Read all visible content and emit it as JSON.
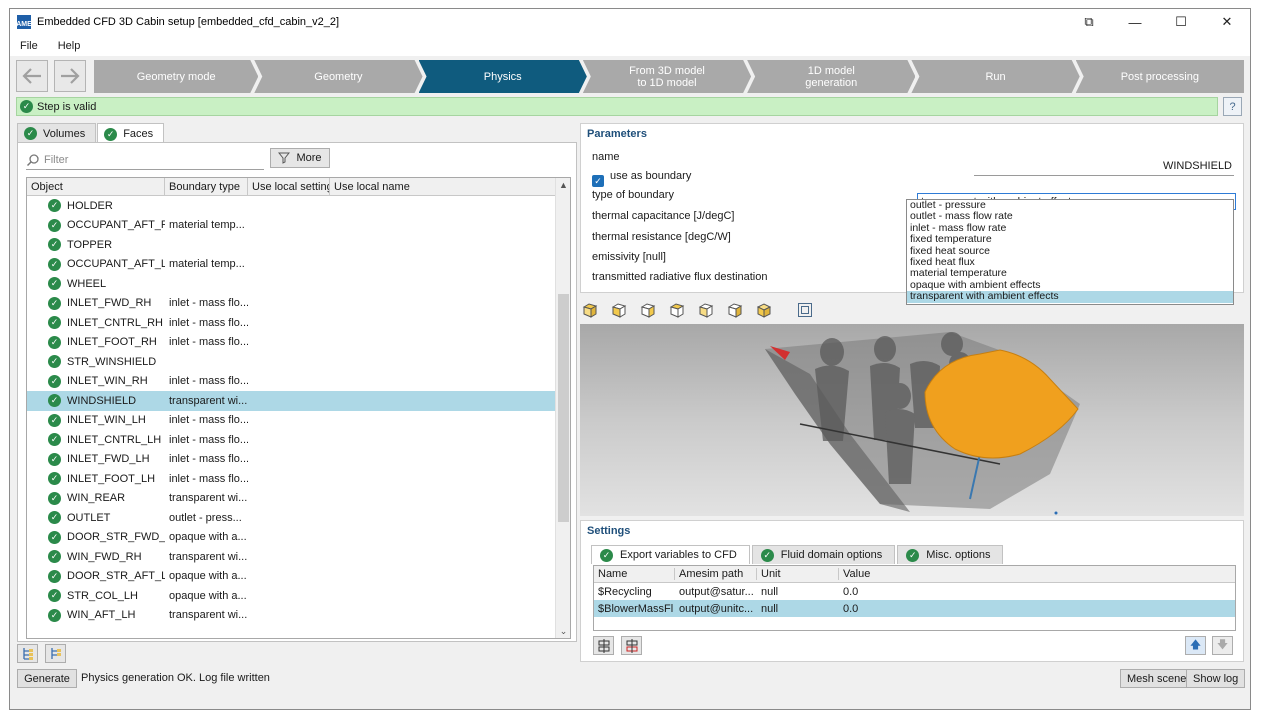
{
  "window": {
    "title": "Embedded CFD 3D Cabin setup [embedded_cfd_cabin_v2_2]",
    "app_icon_text": "AME",
    "controls": {
      "restore": "⧉",
      "minimize": "—",
      "maximize": "☐",
      "close": "✕"
    }
  },
  "menu": [
    "File",
    "Help"
  ],
  "stepper": {
    "back_icon": "arrow-left-icon",
    "forward_icon": "arrow-right-icon",
    "steps": [
      {
        "line1": "Geometry mode",
        "line2": ""
      },
      {
        "line1": "Geometry",
        "line2": ""
      },
      {
        "line1": "Physics",
        "line2": ""
      },
      {
        "line1": "From 3D model",
        "line2": "to 1D model"
      },
      {
        "line1": "1D model",
        "line2": "generation"
      },
      {
        "line1": "Run",
        "line2": ""
      },
      {
        "line1": "Post processing",
        "line2": ""
      }
    ],
    "active_index": 2,
    "active_color": "#0f5b7e",
    "inactive_color": "#a9a9a9"
  },
  "validation": {
    "text": "Step is valid",
    "help": "?",
    "color": "#c9f0c4"
  },
  "left": {
    "tabs": [
      "Volumes",
      "Faces"
    ],
    "active_tab": 1,
    "filter_placeholder": "Filter",
    "more_label": "More",
    "columns": [
      "Object",
      "Boundary type",
      "Use local settings",
      "Use local name"
    ],
    "rows": [
      {
        "object": "HOLDER",
        "boundary": ""
      },
      {
        "object": "OCCUPANT_AFT_RH",
        "boundary": "material temp..."
      },
      {
        "object": "TOPPER",
        "boundary": ""
      },
      {
        "object": "OCCUPANT_AFT_LH",
        "boundary": "material temp..."
      },
      {
        "object": "WHEEL",
        "boundary": ""
      },
      {
        "object": "INLET_FWD_RH",
        "boundary": "inlet - mass flo..."
      },
      {
        "object": "INLET_CNTRL_RH",
        "boundary": "inlet - mass flo..."
      },
      {
        "object": "INLET_FOOT_RH",
        "boundary": "inlet - mass flo..."
      },
      {
        "object": "STR_WINSHIELD",
        "boundary": ""
      },
      {
        "object": "INLET_WIN_RH",
        "boundary": "inlet - mass flo..."
      },
      {
        "object": "WINDSHIELD",
        "boundary": "transparent wi...",
        "selected": true
      },
      {
        "object": "INLET_WIN_LH",
        "boundary": "inlet - mass flo..."
      },
      {
        "object": "INLET_CNTRL_LH",
        "boundary": "inlet - mass flo..."
      },
      {
        "object": "INLET_FWD_LH",
        "boundary": "inlet - mass flo..."
      },
      {
        "object": "INLET_FOOT_LH",
        "boundary": "inlet - mass flo..."
      },
      {
        "object": "WIN_REAR",
        "boundary": "transparent wi..."
      },
      {
        "object": "OUTLET",
        "boundary": "outlet - press..."
      },
      {
        "object": "DOOR_STR_FWD_RH",
        "boundary": "opaque with a..."
      },
      {
        "object": "WIN_FWD_RH",
        "boundary": "transparent wi..."
      },
      {
        "object": "DOOR_STR_AFT_LH",
        "boundary": "opaque with a..."
      },
      {
        "object": "STR_COL_LH",
        "boundary": "opaque with a..."
      },
      {
        "object": "WIN_AFT_LH",
        "boundary": "transparent wi..."
      }
    ]
  },
  "status": {
    "generate_label": "Generate",
    "message": "Physics generation OK. Log file written"
  },
  "parameters": {
    "title": "Parameters",
    "name_label": "name",
    "name_value": "WINDSHIELD",
    "use_as_boundary_label": "use as boundary",
    "use_as_boundary_checked": true,
    "type_label": "type of boundary",
    "type_value": "transparent with ambient effects",
    "thermal_capacitance_label": "thermal capacitance [J/degC]",
    "thermal_resistance_label": "thermal resistance [degC/W]",
    "emissivity_label": "emissivity [null]",
    "flux_dest_label": "transmitted radiative flux destination",
    "options": [
      "outlet - pressure",
      "outlet - mass flow rate",
      "inlet - mass flow rate",
      "fixed temperature",
      "fixed heat source",
      "fixed heat flux",
      "material temperature",
      "opaque with ambient effects",
      "transparent with ambient effects"
    ],
    "highlighted_option": 8
  },
  "view_tools": [
    "cube-front-view-icon",
    "cube-back-view-icon",
    "cube-left-view-icon",
    "cube-right-view-icon",
    "cube-top-view-icon",
    "cube-bottom-view-icon",
    "cube-iso-view-icon",
    "fit-view-icon"
  ],
  "settings": {
    "title": "Settings",
    "tabs": [
      "Export variables to CFD",
      "Fluid domain options",
      "Misc. options"
    ],
    "active_tab": 0,
    "columns": [
      "Name",
      "Amesim path",
      "Unit",
      "Value"
    ],
    "rows": [
      {
        "name": "$Recycling",
        "path": "output@satur...",
        "unit": "null",
        "value": "0.0"
      },
      {
        "name": "$BlowerMassFl...",
        "path": "output@unitc...",
        "unit": "null",
        "value": "0.0",
        "selected": true
      }
    ]
  },
  "buttons": {
    "mesh_scene": "Mesh scene",
    "show_log": "Show log"
  },
  "colors": {
    "selection": "#add8e6",
    "ok_green": "#2b8a4a",
    "windshield": "#f0a01e",
    "title_blue": "#1f4f7a"
  }
}
